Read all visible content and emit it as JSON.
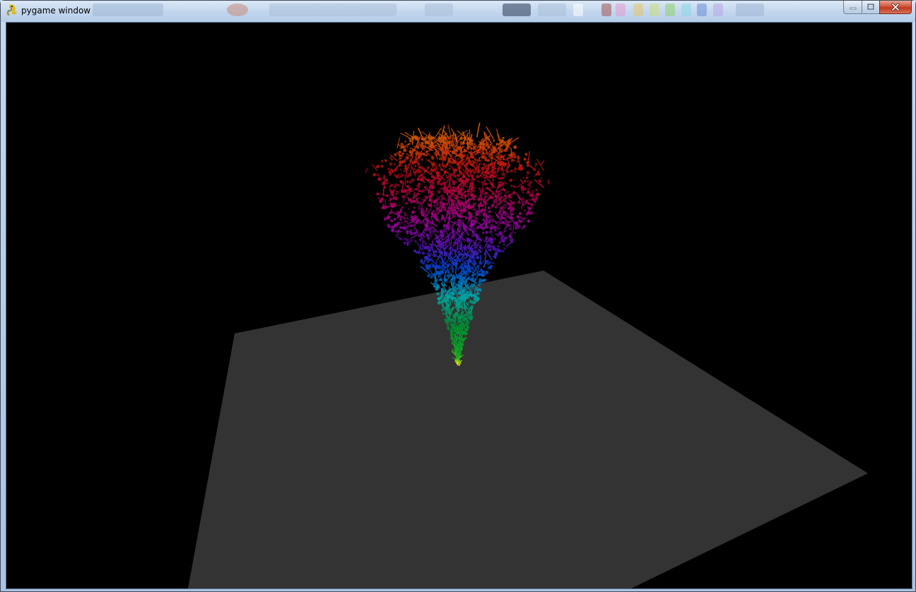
{
  "window": {
    "title": "pygame window",
    "app_icon": "pygame-snake-icon",
    "buttons": {
      "minimize_icon": "minimize-icon",
      "maximize_icon": "maximize-icon",
      "close_icon": "close-icon"
    }
  },
  "scene": {
    "background_color": "#000000",
    "ground_color": "#333333",
    "tree_gradient": [
      "#ffff00",
      "#008800",
      "#00aaaa",
      "#0033bb",
      "#880099",
      "#aa0000",
      "#cc5500"
    ]
  }
}
